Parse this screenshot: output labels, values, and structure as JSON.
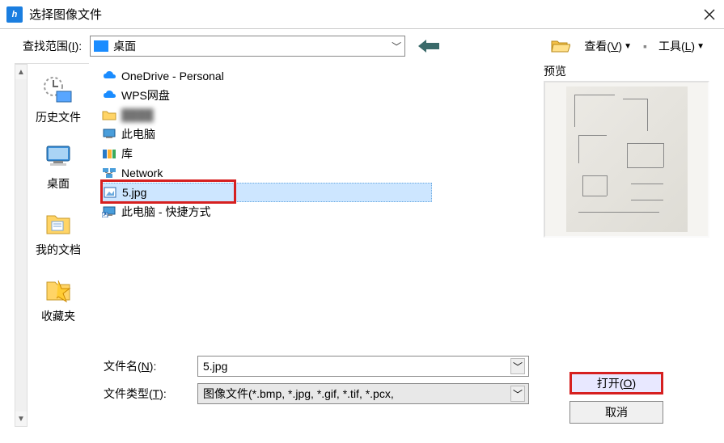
{
  "title": "选择图像文件",
  "toolbar": {
    "look_in_label": "查找范围",
    "look_in_key": "I",
    "current_folder": "桌面",
    "view_label": "查看",
    "view_key": "V",
    "tools_label": "工具",
    "tools_key": "L"
  },
  "sidebar": {
    "items": [
      {
        "label": "历史文件"
      },
      {
        "label": "桌面"
      },
      {
        "label": "我的文档"
      },
      {
        "label": "收藏夹"
      }
    ]
  },
  "files": {
    "items": [
      {
        "name": "OneDrive - Personal",
        "icon": "cloud-blue"
      },
      {
        "name": "WPS网盘",
        "icon": "cloud-blue"
      },
      {
        "name": "",
        "icon": "folder-yellow",
        "blurred": true
      },
      {
        "name": "此电脑",
        "icon": "pc"
      },
      {
        "name": "库",
        "icon": "libraries"
      },
      {
        "name": "Network",
        "icon": "network"
      },
      {
        "name": "5.jpg",
        "icon": "image",
        "selected": true,
        "highlighted": true
      },
      {
        "name": "此电脑 - 快捷方式",
        "icon": "pc-shortcut"
      }
    ]
  },
  "preview_label": "预览",
  "fields": {
    "filename_label": "文件名",
    "filename_key": "N",
    "filename_value": "5.jpg",
    "filetype_label": "文件类型",
    "filetype_key": "T",
    "filetype_value": "图像文件(*.bmp, *.jpg, *.gif, *.tif, *.pcx,"
  },
  "buttons": {
    "open": "打开",
    "open_key": "O",
    "cancel": "取消"
  }
}
